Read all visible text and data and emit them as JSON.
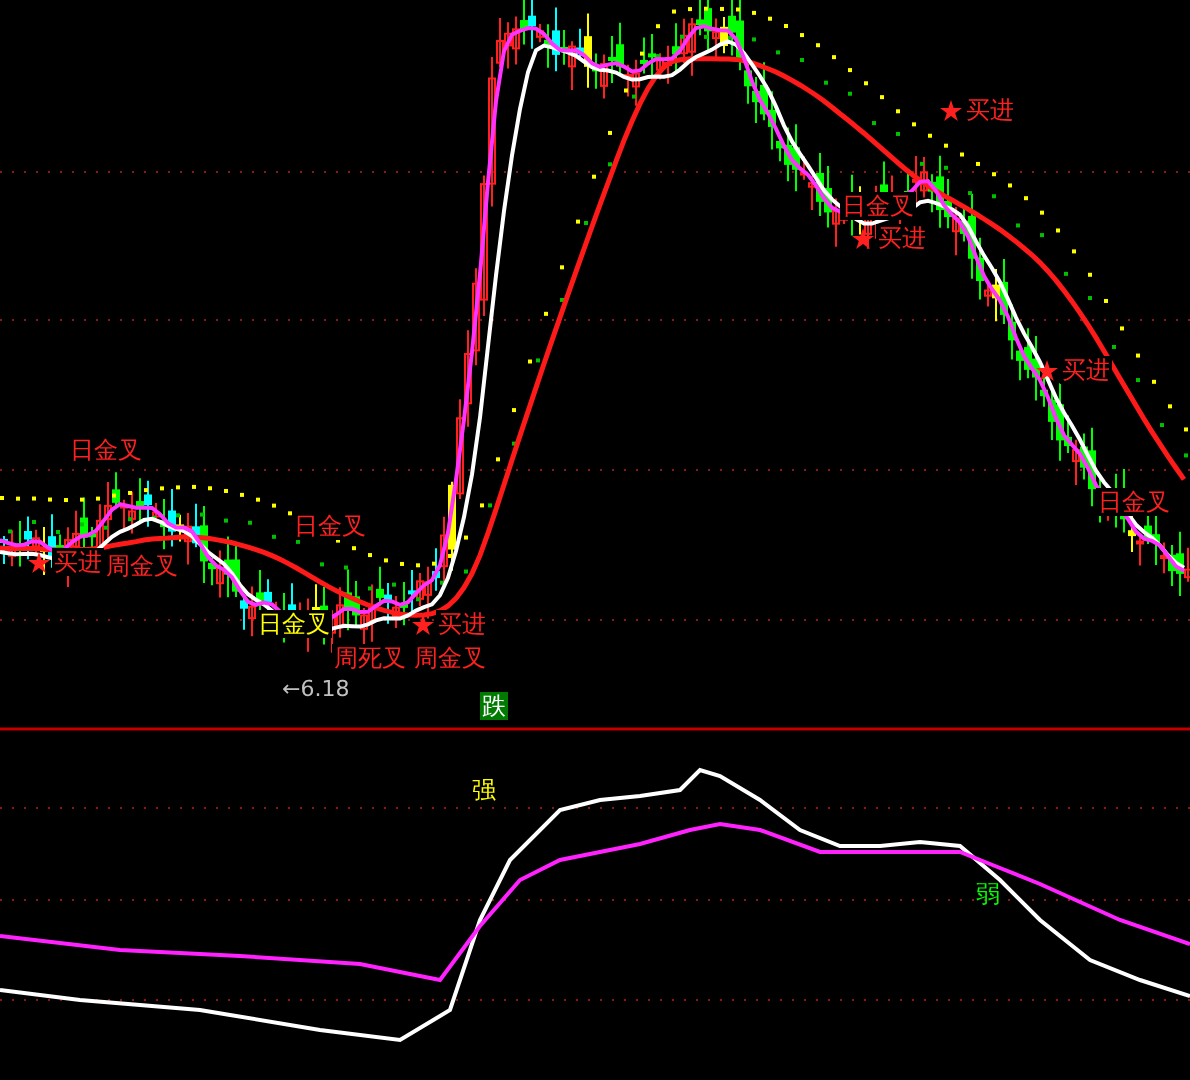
{
  "price_pane": {
    "signals": [
      {
        "kind": "cross",
        "text": "日金叉",
        "color": "#ff2020"
      },
      {
        "kind": "buy",
        "text": "买进",
        "color": "#ff2020"
      },
      {
        "kind": "cross",
        "text": "周金叉",
        "color": "#ff2020"
      },
      {
        "kind": "cross",
        "text": "日金叉",
        "color": "#ff2020"
      },
      {
        "kind": "cross",
        "text": "日金叉",
        "color": "#ffff00"
      },
      {
        "kind": "cross",
        "text": "周死叉",
        "color": "#ff2020"
      },
      {
        "kind": "buy",
        "text": "买进",
        "color": "#ff2020"
      },
      {
        "kind": "cross",
        "text": "周金叉",
        "color": "#ff2020"
      },
      {
        "kind": "price",
        "text": "←6.18",
        "color": "#c0c0c0"
      },
      {
        "kind": "buy",
        "text": "买进",
        "color": "#ff2020"
      },
      {
        "kind": "cross",
        "text": "日金叉",
        "color": "#ff2020"
      },
      {
        "kind": "buy",
        "text": "买进",
        "color": "#ff2020"
      },
      {
        "kind": "buy",
        "text": "买进",
        "color": "#ff2020"
      },
      {
        "kind": "cross",
        "text": "日金叉",
        "color": "#ff2020"
      }
    ]
  },
  "indicator_pane": {
    "labels": [
      {
        "kind": "badge",
        "text": "跌"
      },
      {
        "kind": "strong",
        "text": "强"
      },
      {
        "kind": "weak",
        "text": "弱"
      }
    ]
  }
}
